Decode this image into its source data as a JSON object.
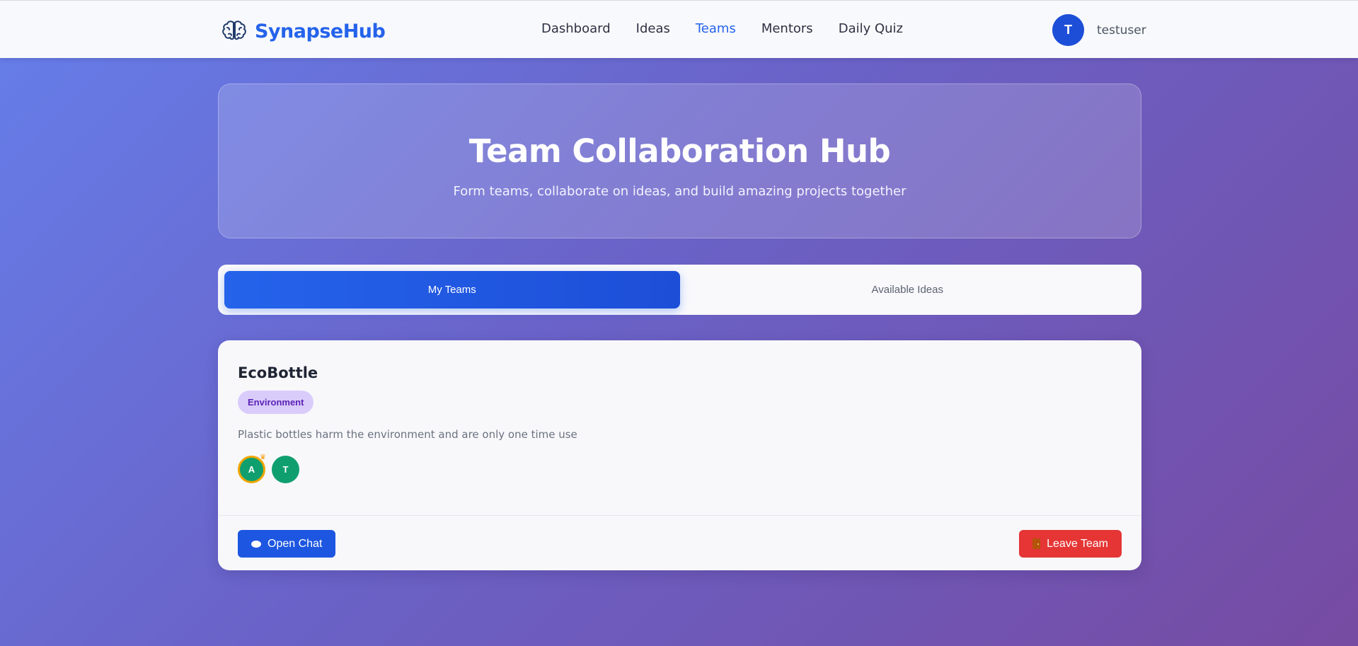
{
  "nav": {
    "brand": "SynapseHub",
    "brand_icon": "brain-icon",
    "links": [
      "Dashboard",
      "Ideas",
      "Teams",
      "Mentors",
      "Daily Quiz"
    ],
    "active_link": "Teams",
    "user": {
      "initial": "T",
      "name": "testuser"
    }
  },
  "hero": {
    "title": "Team Collaboration Hub",
    "subtitle": "Form teams, collaborate on ideas, and build amazing projects together"
  },
  "tabs": [
    {
      "label": "My Teams",
      "active": true
    },
    {
      "label": "Available Ideas",
      "active": false
    }
  ],
  "team": {
    "name": "EcoBottle",
    "category": "Environment",
    "description": "Plastic bottles harm the environment and are only one time use",
    "members": [
      {
        "initial": "A",
        "leader": true
      },
      {
        "initial": "T",
        "leader": false
      }
    ],
    "open_chat_label": "Open Chat",
    "leave_label": "Leave Team"
  },
  "colors": {
    "accent": "#2563eb",
    "danger": "#e53535",
    "member": "#0f9f6e",
    "tag_bg": "#d9ccfb",
    "tag_text": "#5b21b6"
  }
}
